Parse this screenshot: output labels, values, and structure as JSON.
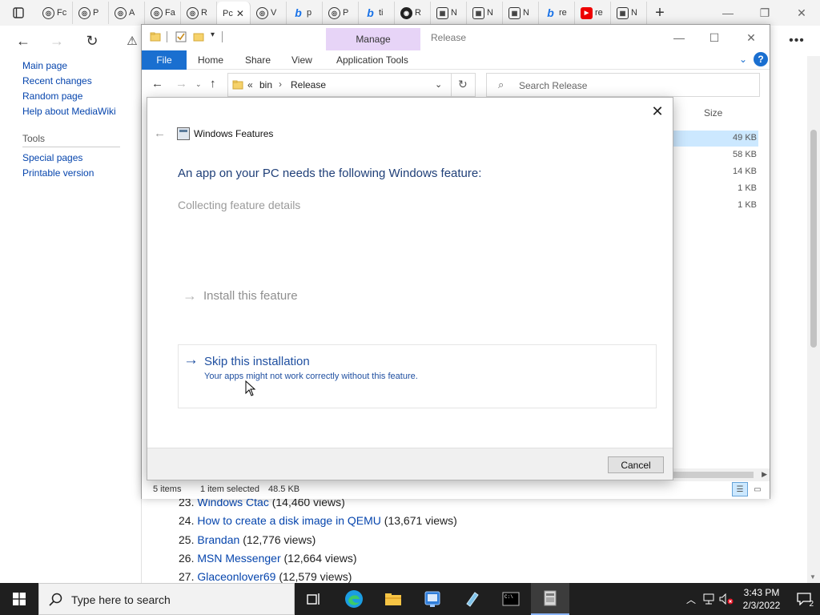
{
  "browser": {
    "tabs": [
      {
        "text": "Fc",
        "icon": "wiki",
        "close": ""
      },
      {
        "text": "P",
        "icon": "wiki",
        "close": ""
      },
      {
        "text": "A",
        "icon": "wiki",
        "close": ""
      },
      {
        "text": "Fa",
        "icon": "wiki",
        "close": ""
      },
      {
        "text": "R",
        "icon": "wiki",
        "close": ""
      },
      {
        "text": "Pc",
        "icon": "",
        "close": "✕",
        "active": true
      },
      {
        "text": "V",
        "icon": "wiki",
        "close": ""
      },
      {
        "text": "p",
        "icon": "bing",
        "close": ""
      },
      {
        "text": "P",
        "icon": "wiki",
        "close": ""
      },
      {
        "text": "ti",
        "icon": "bing",
        "close": ""
      },
      {
        "text": "R",
        "icon": "github",
        "close": ""
      },
      {
        "text": "N",
        "icon": "notebook",
        "close": ""
      },
      {
        "text": "N",
        "icon": "notebook",
        "close": ""
      },
      {
        "text": "N",
        "icon": "notebook",
        "close": ""
      },
      {
        "text": "re",
        "icon": "bing",
        "close": ""
      },
      {
        "text": "re",
        "icon": "youtube",
        "close": ""
      },
      {
        "text": "N",
        "icon": "notebook",
        "close": ""
      }
    ],
    "new_tab": "+"
  },
  "wiki": {
    "sidebar_links": [
      "Main page",
      "Recent changes",
      "Random page",
      "Help about MediaWiki"
    ],
    "tools_heading": "Tools",
    "tools_links": [
      "Special pages",
      "Printable version"
    ],
    "rankings": [
      {
        "num": "23.",
        "title": "Windows Ctac",
        "views": "(14,460 views)"
      },
      {
        "num": "24.",
        "title": "How to create a disk image in QEMU",
        "views": "(13,671 views)"
      },
      {
        "num": "25.",
        "title": "Brandan",
        "views": "(12,776 views)"
      },
      {
        "num": "26.",
        "title": "MSN Messenger",
        "views": "(12,664 views)"
      },
      {
        "num": "27.",
        "title": "Glaceonlover69",
        "views": "(12,579 views)"
      }
    ]
  },
  "explorer": {
    "manage_tab": "Manage",
    "window_title": "Release",
    "ribbon_tabs": {
      "file": "File",
      "home": "Home",
      "share": "Share",
      "view": "View",
      "app_tools": "Application Tools"
    },
    "help": "?",
    "breadcrumb": {
      "overflow": "«",
      "parent": "bin",
      "current": "Release"
    },
    "search_placeholder": "Search Release",
    "size_header": "Size",
    "sizes": [
      "49 KB",
      "58 KB",
      "14 KB",
      "1 KB",
      "1 KB"
    ],
    "status": {
      "items": "5 items",
      "selected": "1 item selected",
      "size": "48.5 KB"
    }
  },
  "dialog": {
    "title": "Windows Features",
    "heading": "An app on your PC needs the following Windows feature:",
    "collecting": "Collecting feature details",
    "install_option": "Install this feature",
    "skip_option": "Skip this installation",
    "skip_description": "Your apps might not work correctly without this feature.",
    "cancel": "Cancel"
  },
  "taskbar": {
    "search_placeholder": "Type here to search",
    "time": "3:43 PM",
    "date": "2/3/2022",
    "notification_count": "2"
  }
}
